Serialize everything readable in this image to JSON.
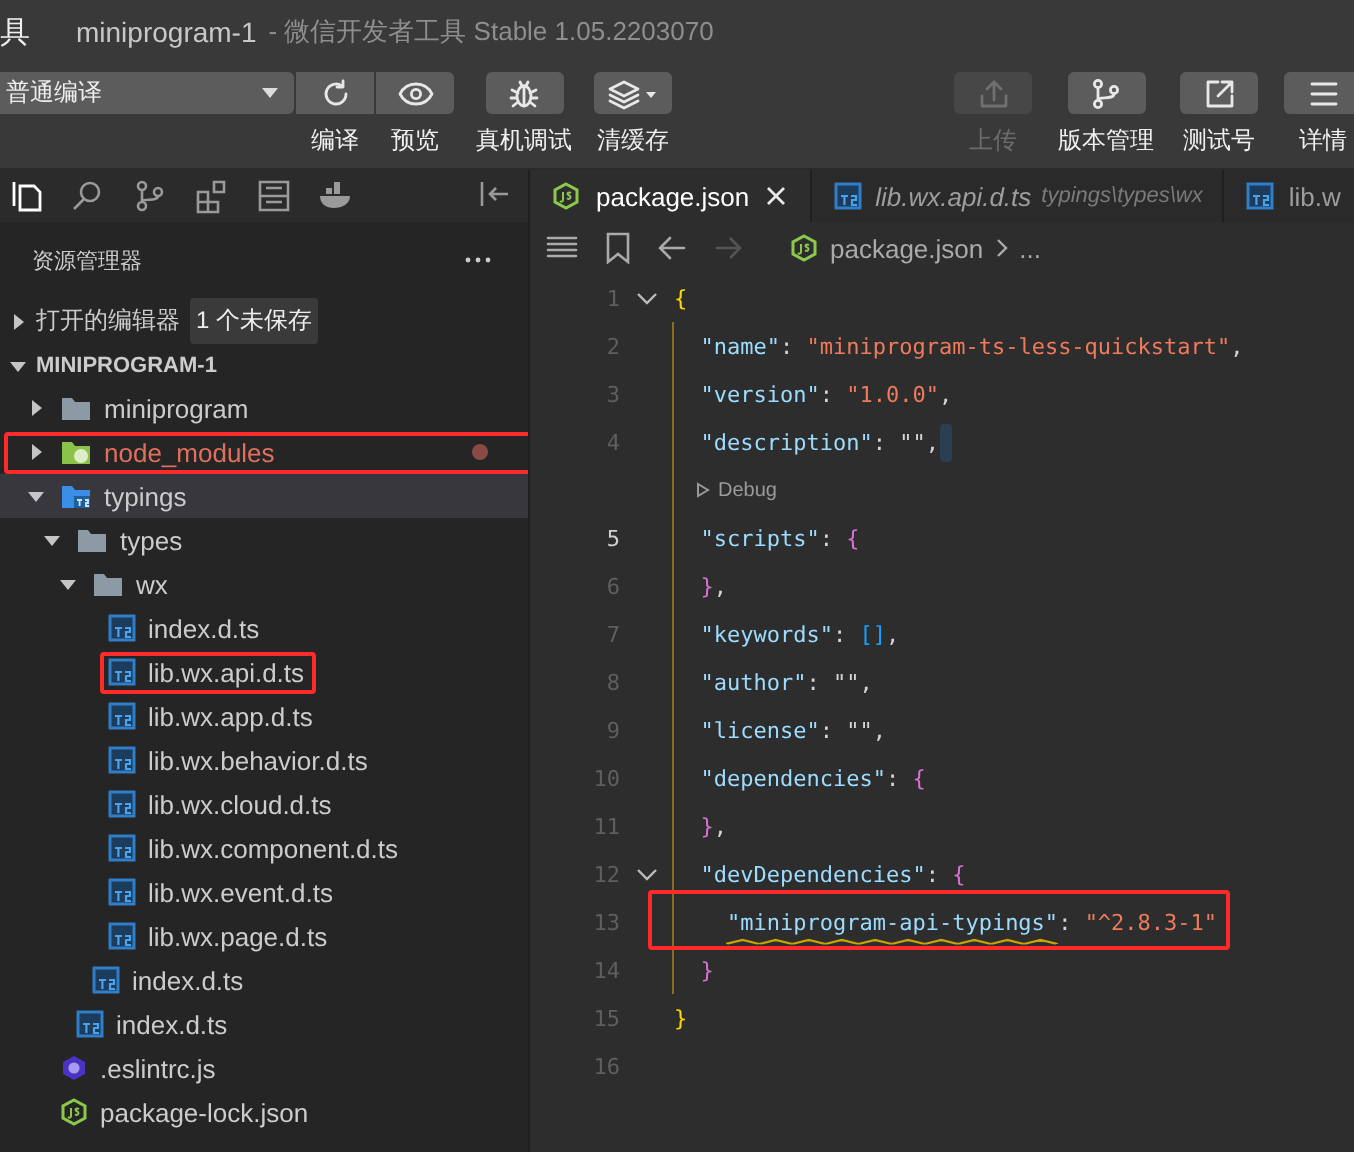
{
  "title_bar": {
    "menu": "具",
    "project": "miniprogram-1",
    "app": "- 微信开发者工具 Stable 1.05.2203070"
  },
  "toolbar": {
    "compile_mode": "普通编译",
    "left": [
      {
        "kind": "compile",
        "label": "编译",
        "disabled": false
      },
      {
        "kind": "preview",
        "label": "预览",
        "disabled": false
      },
      {
        "kind": "debug",
        "label": "真机调试",
        "disabled": false
      },
      {
        "kind": "cache",
        "label": "清缓存",
        "disabled": false
      }
    ],
    "right": [
      {
        "kind": "upload",
        "label": "上传",
        "disabled": true
      },
      {
        "kind": "version",
        "label": "版本管理",
        "disabled": false
      },
      {
        "kind": "test",
        "label": "测试号",
        "disabled": false
      },
      {
        "kind": "details",
        "label": "详情",
        "disabled": false
      }
    ]
  },
  "sidebar": {
    "title": "资源管理器",
    "open_editors": {
      "title": "打开的编辑器",
      "badge": "1 个未保存",
      "expanded": false
    },
    "project": {
      "title": "MINIPROGRAM-1",
      "expanded": true,
      "tree": [
        {
          "label": "miniprogram",
          "kind": "folder",
          "expanded": false,
          "selected": false,
          "modified": false,
          "highlighted": false
        },
        {
          "label": "node_modules",
          "kind": "node-folder",
          "expanded": false,
          "selected": false,
          "modified": true,
          "highlighted": true
        },
        {
          "label": "typings",
          "kind": "ts-folder",
          "expanded": true,
          "selected": true,
          "modified": false,
          "highlighted": false,
          "children": [
            {
              "label": "types",
              "kind": "folder",
              "expanded": true,
              "selected": false,
              "modified": false,
              "highlighted": false,
              "children": [
                {
                  "label": "wx",
                  "kind": "folder",
                  "expanded": true,
                  "selected": false,
                  "modified": false,
                  "highlighted": false,
                  "children": [
                    {
                      "label": "index.d.ts",
                      "kind": "ts",
                      "selected": false,
                      "modified": false,
                      "highlighted": false
                    },
                    {
                      "label": "lib.wx.api.d.ts",
                      "kind": "ts",
                      "selected": false,
                      "modified": false,
                      "highlighted": true
                    },
                    {
                      "label": "lib.wx.app.d.ts",
                      "kind": "ts",
                      "selected": false,
                      "modified": false,
                      "highlighted": false
                    },
                    {
                      "label": "lib.wx.behavior.d.ts",
                      "kind": "ts",
                      "selected": false,
                      "modified": false,
                      "highlighted": false
                    },
                    {
                      "label": "lib.wx.cloud.d.ts",
                      "kind": "ts",
                      "selected": false,
                      "modified": false,
                      "highlighted": false
                    },
                    {
                      "label": "lib.wx.component.d.ts",
                      "kind": "ts",
                      "selected": false,
                      "modified": false,
                      "highlighted": false
                    },
                    {
                      "label": "lib.wx.event.d.ts",
                      "kind": "ts",
                      "selected": false,
                      "modified": false,
                      "highlighted": false
                    },
                    {
                      "label": "lib.wx.page.d.ts",
                      "kind": "ts",
                      "selected": false,
                      "modified": false,
                      "highlighted": false
                    }
                  ]
                },
                {
                  "label": "index.d.ts",
                  "kind": "ts",
                  "selected": false,
                  "modified": false,
                  "highlighted": false
                }
              ]
            },
            {
              "label": "index.d.ts",
              "kind": "ts",
              "selected": false,
              "modified": false,
              "highlighted": false
            }
          ]
        },
        {
          "label": ".eslintrc.js",
          "kind": "eslint",
          "selected": false,
          "modified": false,
          "highlighted": false
        },
        {
          "label": "package-lock.json",
          "kind": "node",
          "selected": false,
          "modified": false,
          "highlighted": false
        }
      ]
    }
  },
  "editor": {
    "tabs": [
      {
        "label": "package.json",
        "kind": "json",
        "selected": true,
        "preview": false
      },
      {
        "label": "lib.wx.api.d.ts",
        "description": "typings\\types\\wx",
        "kind": "ts",
        "selected": false,
        "preview": true
      },
      {
        "label": "lib.w",
        "kind": "ts",
        "selected": false,
        "preview": false
      }
    ],
    "breadcrumb": {
      "file": "package.json",
      "more": "..."
    },
    "lines": [
      {
        "kind": "code",
        "number": "1",
        "foldable": true,
        "active": false,
        "highlighted": false,
        "cursor": false,
        "warning": false,
        "tokens": [
          {
            "text": "{",
            "kind": "brace-gold"
          }
        ]
      },
      {
        "kind": "code",
        "number": "2",
        "foldable": false,
        "active": false,
        "highlighted": false,
        "cursor": false,
        "warning": false,
        "tokens": [
          {
            "text": "  \"name\"",
            "kind": "key"
          },
          {
            "text": ": ",
            "kind": "punct"
          },
          {
            "text": "\"miniprogram-ts-less-quickstart\"",
            "kind": "string"
          },
          {
            "text": ",",
            "kind": "punct"
          }
        ]
      },
      {
        "kind": "code",
        "number": "3",
        "foldable": false,
        "active": false,
        "highlighted": false,
        "cursor": false,
        "warning": false,
        "tokens": [
          {
            "text": "  \"version\"",
            "kind": "key"
          },
          {
            "text": ": ",
            "kind": "punct"
          },
          {
            "text": "\"1.0.0\"",
            "kind": "string"
          },
          {
            "text": ",",
            "kind": "punct"
          }
        ]
      },
      {
        "kind": "code",
        "number": "4",
        "foldable": false,
        "active": false,
        "highlighted": false,
        "cursor": true,
        "warning": false,
        "tokens": [
          {
            "text": "  \"description\"",
            "kind": "key"
          },
          {
            "text": ": \"\",",
            "kind": "punct"
          }
        ]
      },
      {
        "kind": "codelens",
        "text": "Debug"
      },
      {
        "kind": "code",
        "number": "5",
        "foldable": false,
        "active": true,
        "highlighted": false,
        "cursor": false,
        "warning": false,
        "tokens": [
          {
            "text": "  \"scripts\"",
            "kind": "key"
          },
          {
            "text": ": ",
            "kind": "punct"
          },
          {
            "text": "{",
            "kind": "brace-pink"
          }
        ]
      },
      {
        "kind": "code",
        "number": "6",
        "foldable": false,
        "active": false,
        "highlighted": false,
        "cursor": false,
        "warning": false,
        "tokens": [
          {
            "text": "  }",
            "kind": "brace-pink"
          },
          {
            "text": ",",
            "kind": "punct"
          }
        ]
      },
      {
        "kind": "code",
        "number": "7",
        "foldable": false,
        "active": false,
        "highlighted": false,
        "cursor": false,
        "warning": false,
        "tokens": [
          {
            "text": "  \"keywords\"",
            "kind": "key"
          },
          {
            "text": ": ",
            "kind": "punct"
          },
          {
            "text": "[]",
            "kind": "brace-blue"
          },
          {
            "text": ",",
            "kind": "punct"
          }
        ]
      },
      {
        "kind": "code",
        "number": "8",
        "foldable": false,
        "active": false,
        "highlighted": false,
        "cursor": false,
        "warning": false,
        "tokens": [
          {
            "text": "  \"author\"",
            "kind": "key"
          },
          {
            "text": ": \"\",",
            "kind": "punct"
          }
        ]
      },
      {
        "kind": "code",
        "number": "9",
        "foldable": false,
        "active": false,
        "highlighted": false,
        "cursor": false,
        "warning": false,
        "tokens": [
          {
            "text": "  \"license\"",
            "kind": "key"
          },
          {
            "text": ": \"\",",
            "kind": "punct"
          }
        ]
      },
      {
        "kind": "code",
        "number": "10",
        "foldable": false,
        "active": false,
        "highlighted": false,
        "cursor": false,
        "warning": false,
        "tokens": [
          {
            "text": "  \"dependencies\"",
            "kind": "key"
          },
          {
            "text": ": ",
            "kind": "punct"
          },
          {
            "text": "{",
            "kind": "brace-pink"
          }
        ]
      },
      {
        "kind": "code",
        "number": "11",
        "foldable": false,
        "active": false,
        "highlighted": false,
        "cursor": false,
        "warning": false,
        "tokens": [
          {
            "text": "  }",
            "kind": "brace-pink"
          },
          {
            "text": ",",
            "kind": "punct"
          }
        ]
      },
      {
        "kind": "code",
        "number": "12",
        "foldable": true,
        "active": false,
        "highlighted": false,
        "cursor": false,
        "warning": false,
        "tokens": [
          {
            "text": "  \"devDependencies\"",
            "kind": "key"
          },
          {
            "text": ": ",
            "kind": "punct"
          },
          {
            "text": "{",
            "kind": "brace-pink"
          }
        ]
      },
      {
        "kind": "code",
        "number": "13",
        "foldable": false,
        "active": false,
        "highlighted": true,
        "cursor": false,
        "warning": true,
        "tokens": [
          {
            "text": "    \"miniprogram-api-typings\"",
            "kind": "key"
          },
          {
            "text": ": ",
            "kind": "punct"
          },
          {
            "text": "\"^2.8.3-1\"",
            "kind": "string"
          }
        ]
      },
      {
        "kind": "code",
        "number": "14",
        "foldable": false,
        "active": false,
        "highlighted": false,
        "cursor": false,
        "warning": false,
        "tokens": [
          {
            "text": "  }",
            "kind": "brace-pink"
          }
        ]
      },
      {
        "kind": "code",
        "number": "15",
        "foldable": false,
        "active": false,
        "highlighted": false,
        "cursor": false,
        "warning": false,
        "tokens": [
          {
            "text": "}",
            "kind": "brace-gold"
          }
        ]
      },
      {
        "kind": "code",
        "number": "16",
        "foldable": false,
        "active": false,
        "highlighted": false,
        "cursor": false,
        "warning": false
      }
    ]
  }
}
